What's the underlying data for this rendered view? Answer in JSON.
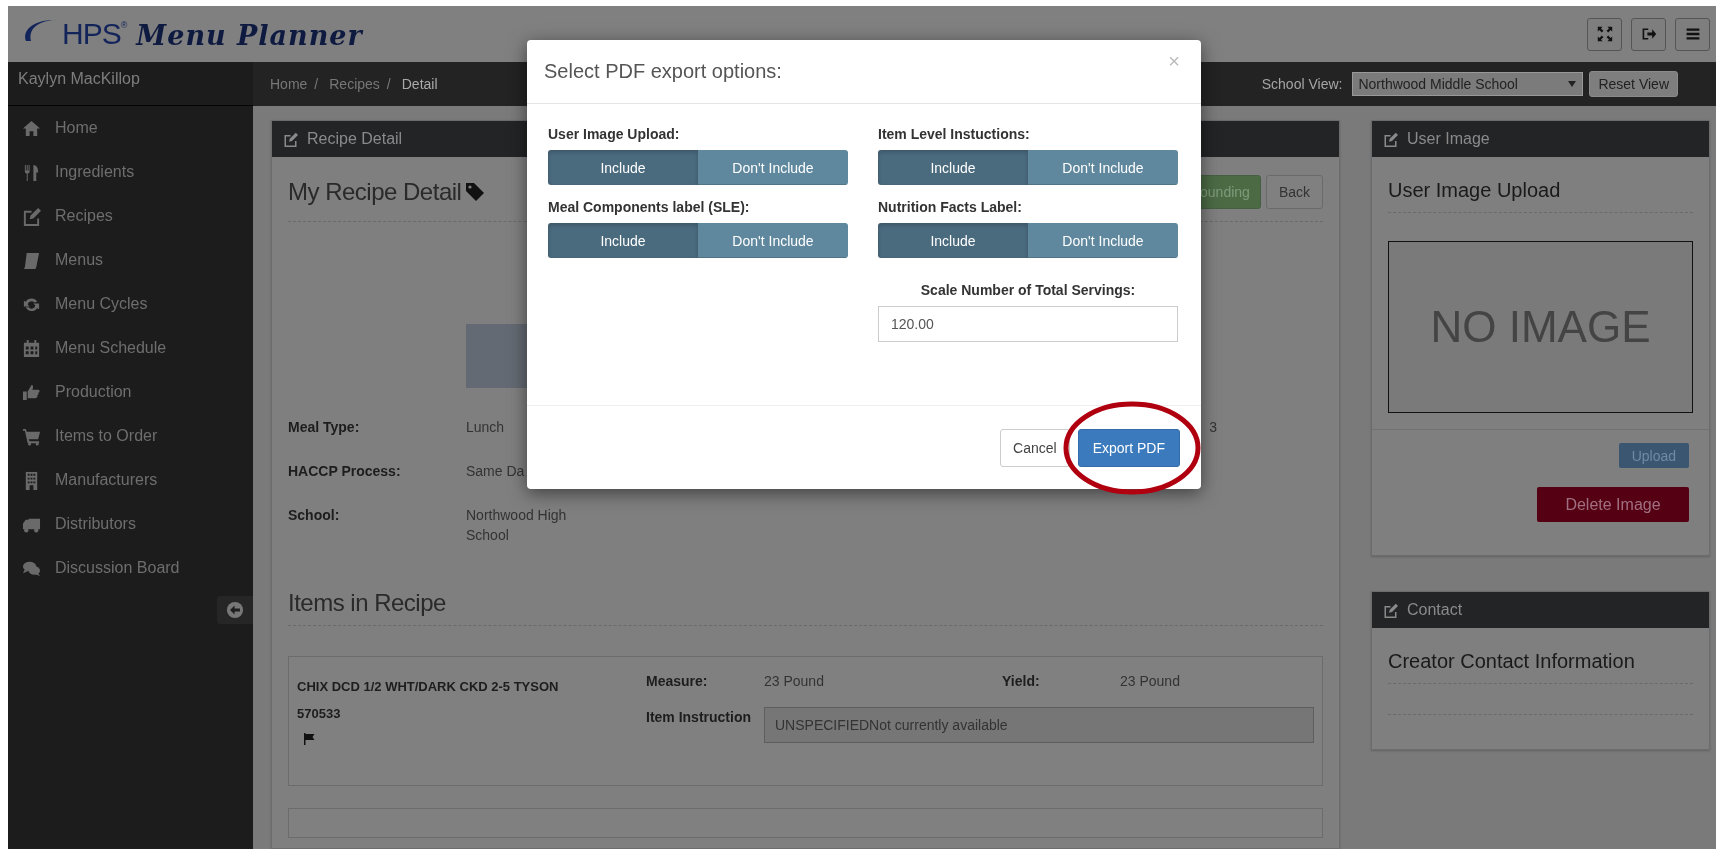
{
  "app": {
    "brand": "HPS$^{®}$",
    "title": "Menu Planner"
  },
  "user": "Kaylyn MacKillop",
  "breadcrumb": [
    {
      "label": "Home",
      "separator": "/",
      "current": false
    },
    {
      "label": "Recipes",
      "separator": "/",
      "current": false
    },
    {
      "label": "Detail",
      "current": true
    }
  ],
  "school_view": {
    "label": "School View:",
    "value": "Northwood Middle School",
    "reset": "Reset View"
  },
  "sidebar": {
    "items": [
      {
        "label": "Home"
      },
      {
        "label": "Ingredients"
      },
      {
        "label": "Recipes"
      },
      {
        "label": "Menus"
      },
      {
        "label": "Menu Cycles"
      },
      {
        "label": "Menu Schedule"
      },
      {
        "label": "Production"
      },
      {
        "label": "Items to Order"
      },
      {
        "label": "Manufacturers"
      },
      {
        "label": "Distributors"
      },
      {
        "label": "Discussion Board"
      }
    ]
  },
  "recipe_panel": {
    "title": "Recipe Detail",
    "heading": "My Recipe Detail",
    "buttons": [
      {
        "label": "ounding",
        "kind": "success"
      },
      {
        "label": "Back",
        "kind": "default"
      }
    ],
    "details": [
      {
        "label": "Meal Type:",
        "value": "Lunch",
        "trailing": "3"
      },
      {
        "label": "HACCP Process:",
        "value": "Same Da"
      },
      {
        "label": "School:",
        "value": "Northwood High School"
      }
    ],
    "items_heading": "Items in Recipe",
    "items": [
      {
        "name": "CHIX DCD 1/2 WHT/DARK CKD 2-5 TYSON",
        "code": "570533",
        "measure_label": "Measure:",
        "measure": "23 Pound",
        "yield_label": "Yield:",
        "yield": "23 Pound",
        "instruction_label": "Item Instruction",
        "instruction": "UNSPECIFIEDNot currently available"
      }
    ]
  },
  "user_image_panel": {
    "title": "User Image",
    "heading": "User Image Upload",
    "empty_text": "NO IMAGE",
    "upload": "Upload",
    "delete": "Delete Image"
  },
  "contact_panel": {
    "title": "Contact",
    "heading": "Creator Contact Information"
  },
  "modal": {
    "title": "Select PDF export options:",
    "close": "×",
    "options": [
      {
        "label": "User Image Upload:",
        "choices": [
          {
            "label": "Include",
            "selected": true
          },
          {
            "label": "Don't Include",
            "selected": false
          }
        ]
      },
      {
        "label": "Item Level Instuctions:",
        "choices": [
          {
            "label": "Include",
            "selected": true
          },
          {
            "label": "Don't Include",
            "selected": false
          }
        ]
      },
      {
        "label": "Meal Components label (SLE):",
        "choices": [
          {
            "label": "Include",
            "selected": true
          },
          {
            "label": "Don't Include",
            "selected": false
          }
        ]
      },
      {
        "label": "Nutrition Facts Label:",
        "choices": [
          {
            "label": "Include",
            "selected": true
          },
          {
            "label": "Don't Include",
            "selected": false
          }
        ]
      }
    ],
    "servings": {
      "label": "Scale Number of Total Servings:",
      "value": "120.00"
    },
    "buttons": [
      {
        "label": "Cancel",
        "kind": "default",
        "highlighted": false
      },
      {
        "label": "Export PDF",
        "kind": "primary",
        "highlighted": true
      }
    ]
  }
}
